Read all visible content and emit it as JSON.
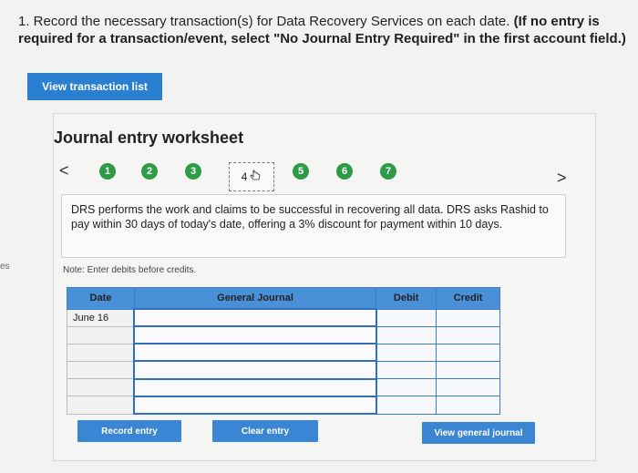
{
  "instructions": {
    "main": "1. Record the necessary transaction(s) for Data Recovery Services on each date. ",
    "bold": "(If no entry is required for a transaction/event, select \"No Journal Entry Required\" in the first account field.)"
  },
  "view_transaction_list": "View transaction list",
  "side_fragment": "es",
  "worksheet": {
    "title": "Journal entry worksheet",
    "nav_prev": "<",
    "nav_next": ">",
    "steps": [
      "1",
      "2",
      "3",
      "4",
      "5",
      "6",
      "7"
    ],
    "current_step": "4",
    "description": "DRS performs the work and claims to be successful in recovering all data. DRS asks Rashid to pay within 30 days of today's date, offering a 3% discount for payment within 10 days.",
    "note": "Note: Enter debits before credits.",
    "table": {
      "headers": [
        "Date",
        "General Journal",
        "Debit",
        "Credit"
      ],
      "rows": [
        [
          "June 16",
          "",
          "",
          ""
        ],
        [
          "",
          "",
          "",
          ""
        ],
        [
          "",
          "",
          "",
          ""
        ],
        [
          "",
          "",
          "",
          ""
        ],
        [
          "",
          "",
          "",
          ""
        ],
        [
          "",
          "",
          "",
          ""
        ]
      ]
    },
    "buttons": {
      "record": "Record entry",
      "clear": "Clear entry",
      "view_journal": "View general journal"
    }
  },
  "colors": {
    "accent_blue": "#2b7fd0",
    "step_green": "#2e9b48",
    "table_header": "#4a90d9"
  }
}
